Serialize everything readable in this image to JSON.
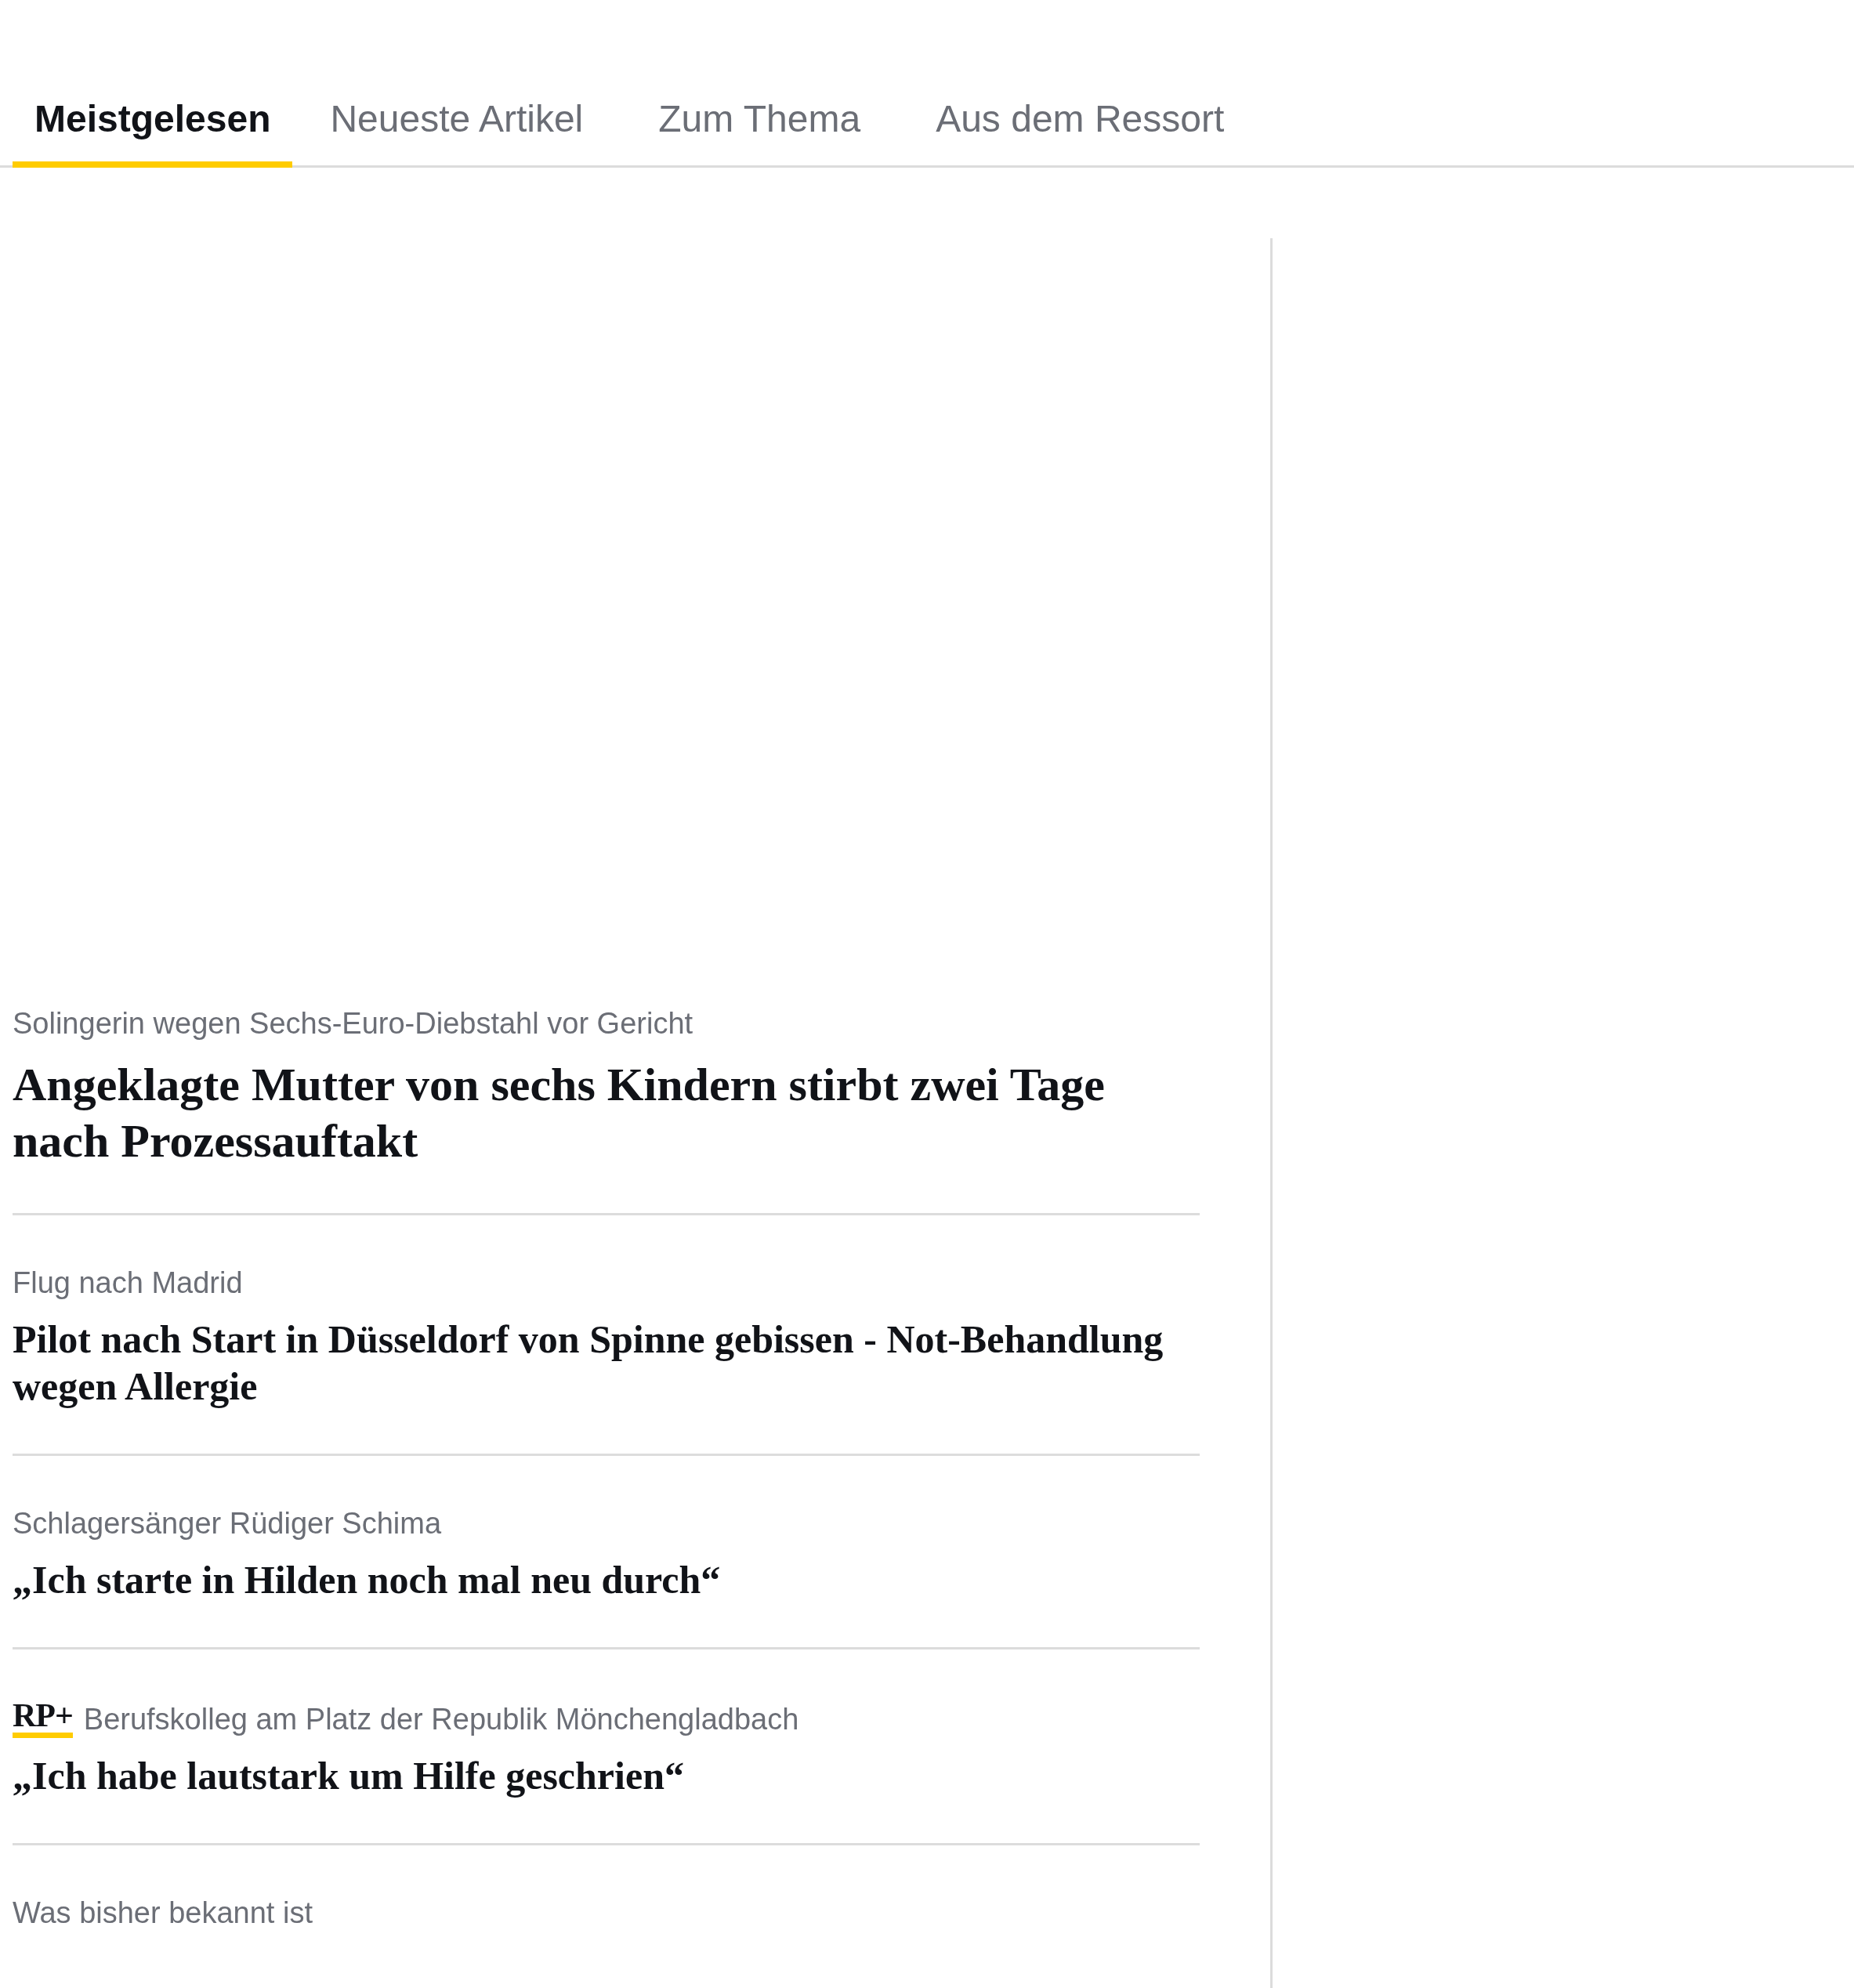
{
  "tabs": [
    {
      "label": "Meistgelesen",
      "selected": true
    },
    {
      "label": "Neueste Artikel",
      "selected": false
    },
    {
      "label": "Zum Thema",
      "selected": false
    },
    {
      "label": "Aus dem Ressort",
      "selected": false
    }
  ],
  "articles": [
    {
      "kicker": "Solingerin wegen Sechs-Euro-Diebstahl vor Gericht",
      "headline": "Angeklagte Mutter von sechs Kindern stirbt zwei Tage nach Prozessauftakt",
      "lead": true
    },
    {
      "kicker": "Flug nach Madrid",
      "headline": "Pilot nach Start in Düsseldorf von Spinne gebissen - Not-Behandlung wegen Allergie",
      "lead": false
    },
    {
      "kicker": "Schlagersänger Rüdiger Schima",
      "headline": "„Ich starte in Hilden noch mal neu durch“",
      "lead": false
    },
    {
      "badge": "RP+",
      "kicker": "Berufskolleg am Platz der Republik Mönchengladbach",
      "headline": "„Ich habe lautstark um Hilfe geschrien“",
      "lead": false
    },
    {
      "kicker": "Was bisher bekannt ist"
    }
  ]
}
